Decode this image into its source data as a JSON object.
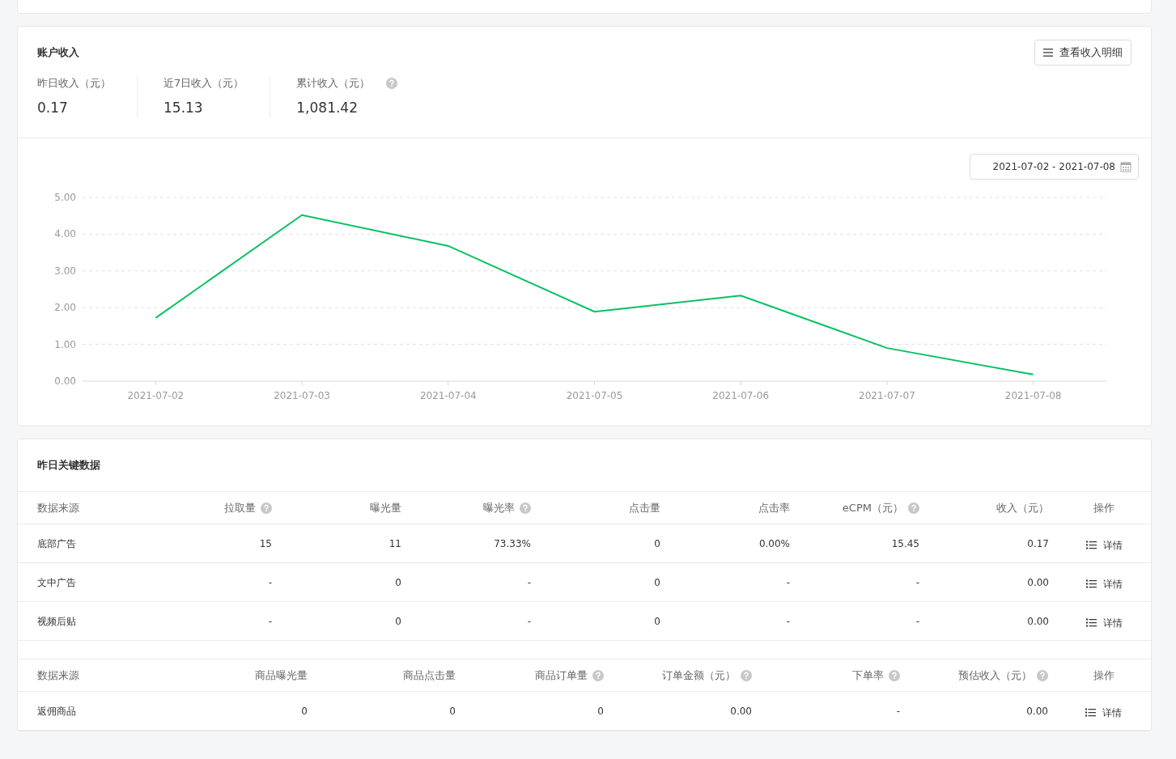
{
  "income_card": {
    "title": "账户收入",
    "detail_button": "查看收入明细",
    "stats": [
      {
        "label": "昨日收入（元）",
        "value": "0.17",
        "help": false
      },
      {
        "label": "近7日收入（元）",
        "value": "15.13",
        "help": false
      },
      {
        "label": "累计收入（元）",
        "value": "1,081.42",
        "help": true
      }
    ],
    "date_range": "2021-07-02 - 2021-07-08",
    "chart_data": {
      "type": "line",
      "categories": [
        "2021-07-02",
        "2021-07-03",
        "2021-07-04",
        "2021-07-05",
        "2021-07-06",
        "2021-07-07",
        "2021-07-08"
      ],
      "grid": true,
      "series": [
        {
          "color": "#07c160",
          "values": [
            1.72,
            4.52,
            3.68,
            1.89,
            2.33,
            0.9,
            0.18
          ]
        }
      ],
      "ylim": [
        0,
        5
      ],
      "yticks": [
        {
          "value": 0,
          "label": "0.00"
        },
        {
          "value": 1,
          "label": "1.00"
        },
        {
          "value": 2,
          "label": "2.00"
        },
        {
          "value": 3,
          "label": "3.00"
        },
        {
          "value": 4,
          "label": "4.00"
        },
        {
          "value": 5,
          "label": "5.00"
        }
      ]
    }
  },
  "key_data_card": {
    "title": "昨日关键数据",
    "tables": [
      {
        "columns": [
          {
            "label": "数据来源",
            "help": false
          },
          {
            "label": "拉取量",
            "help": true
          },
          {
            "label": "曝光量",
            "help": false
          },
          {
            "label": "曝光率",
            "help": true
          },
          {
            "label": "点击量",
            "help": false
          },
          {
            "label": "点击率",
            "help": false
          },
          {
            "label": "eCPM（元）",
            "help": true
          },
          {
            "label": "收入（元）",
            "help": false
          },
          {
            "label": "操作",
            "help": false
          }
        ],
        "rows": [
          {
            "cells": [
              "底部广告",
              "15",
              "11",
              "73.33%",
              "0",
              "0.00%",
              "15.45",
              "0.17"
            ],
            "action": "详情"
          },
          {
            "cells": [
              "文中广告",
              "-",
              "0",
              "-",
              "0",
              "-",
              "-",
              "0.00"
            ],
            "action": "详情"
          },
          {
            "cells": [
              "视频后贴",
              "-",
              "0",
              "-",
              "0",
              "-",
              "-",
              "0.00"
            ],
            "action": "详情"
          }
        ]
      },
      {
        "columns": [
          {
            "label": "数据来源",
            "help": false
          },
          {
            "label": "商品曝光量",
            "help": false
          },
          {
            "label": "商品点击量",
            "help": false
          },
          {
            "label": "商品订单量",
            "help": true
          },
          {
            "label": "订单金额（元）",
            "help": true
          },
          {
            "label": "下单率",
            "help": true
          },
          {
            "label": "预估收入（元）",
            "help": true
          },
          {
            "label": "操作",
            "help": false
          }
        ],
        "rows": [
          {
            "cells": [
              "返佣商品",
              "0",
              "0",
              "0",
              "0.00",
              "-",
              "0.00"
            ],
            "action": "详情"
          }
        ]
      }
    ]
  }
}
